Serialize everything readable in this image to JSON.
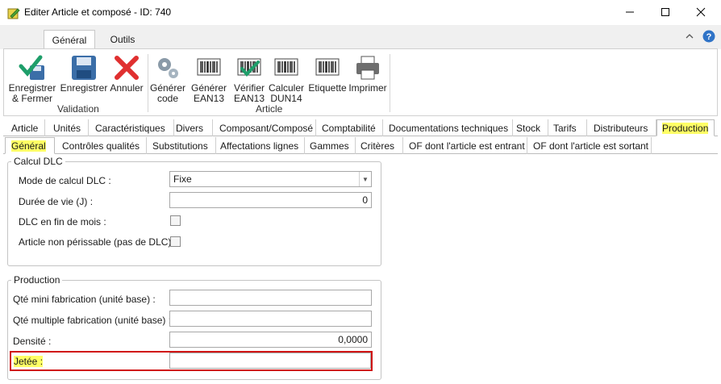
{
  "window": {
    "title": "Editer Article et composé - ID: 740",
    "minimize_glyph": "—",
    "maximize_glyph": "☐",
    "close_glyph": "✕"
  },
  "ribbon": {
    "tabs": [
      {
        "label": "Général",
        "active": true
      },
      {
        "label": "Outils",
        "active": false
      }
    ],
    "groups": [
      {
        "label": "Validation",
        "buttons": [
          {
            "line1": "Enregistrer",
            "line2": "& Fermer",
            "icon": "save-close-icon"
          },
          {
            "line1": "Enregistrer",
            "line2": "",
            "icon": "floppy-disk-icon"
          },
          {
            "line1": "Annuler",
            "line2": "",
            "icon": "red-x-icon"
          }
        ]
      },
      {
        "label": "Article",
        "buttons": [
          {
            "line1": "Générer",
            "line2": "code",
            "icon": "gears-icon"
          },
          {
            "line1": "Générer",
            "line2": "EAN13",
            "icon": "barcode-icon"
          },
          {
            "line1": "Vérifier",
            "line2": "EAN13",
            "icon": "barcode-check-icon"
          },
          {
            "line1": "Calculer",
            "line2": "DUN14",
            "icon": "barcode-icon"
          },
          {
            "line1": "Etiquette",
            "line2": "",
            "icon": "barcode-icon"
          },
          {
            "line1": "Imprimer",
            "line2": "",
            "icon": "printer-icon"
          }
        ]
      }
    ]
  },
  "main_tabs": [
    "Article",
    "Unités",
    "Caractéristiques",
    "Divers",
    "Composant/Composé",
    "Comptabilité",
    "Documentations techniques",
    "Stock",
    "Tarifs",
    "Distributeurs",
    "Production"
  ],
  "main_tabs_active": "Production",
  "sub_tabs": [
    "Général",
    "Contrôles qualités",
    "Substitutions",
    "Affectations lignes",
    "Gammes",
    "Critères",
    "OF dont l'article est entrant",
    "OF dont l'article est sortant"
  ],
  "sub_tabs_active": "Général",
  "calcul_dlc": {
    "title": "Calcul DLC",
    "mode_label": "Mode de calcul DLC :",
    "mode_value": "Fixe",
    "duree_label": "Durée de vie (J) :",
    "duree_value": "0",
    "fin_mois_label": "DLC en fin de mois :",
    "fin_mois_checked": false,
    "non_perissable_label": "Article non périssable (pas de DLC) :",
    "non_perissable_checked": false
  },
  "production": {
    "title": "Production",
    "qte_mini_label": "Qté mini fabrication (unité base) :",
    "qte_mini_value": "",
    "qte_multiple_label": "Qté multiple fabrication (unité base) :",
    "qte_multiple_value": "",
    "densite_label": "Densité :",
    "densite_value": "0,0000",
    "jetee_label": "Jetée :",
    "jetee_value": ""
  },
  "colors": {
    "highlight": "#ffff66",
    "annotation_red": "#d01414",
    "save_blue": "#3b6ea8",
    "check_green": "#1e9e6a",
    "cancel_red": "#e03030",
    "help_blue": "#2f73c7"
  }
}
